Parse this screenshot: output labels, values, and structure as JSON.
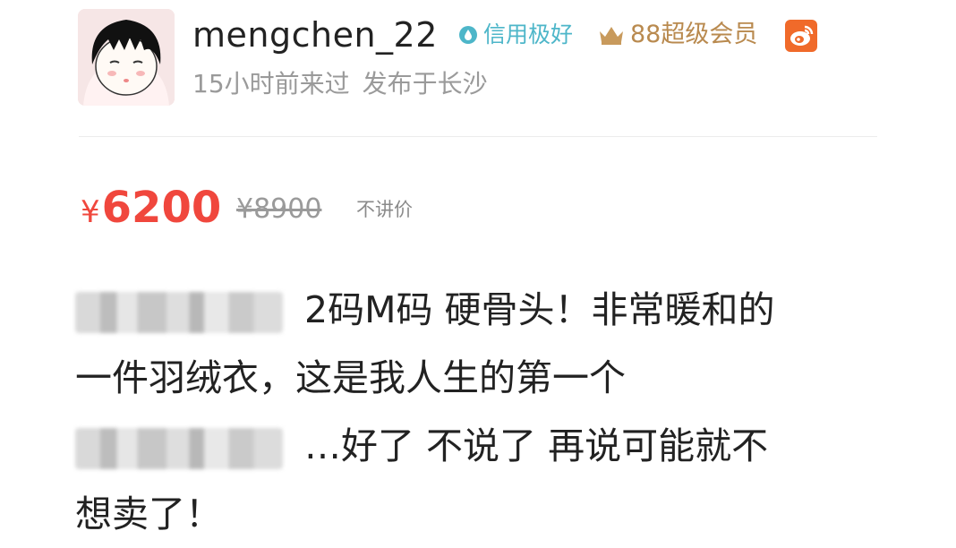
{
  "profile": {
    "username": "mengchen_22",
    "credit_badge": "信用极好",
    "vip_badge": "88超级会员",
    "last_seen": "15小时前来过",
    "location": "发布于长沙"
  },
  "listing": {
    "currency_symbol": "¥",
    "price": "6200",
    "original_price": "¥8900",
    "bargain_note": "不讲价",
    "description": {
      "line1": "2码M码 硬骨头！非常暖和的",
      "line2": "一件羽绒衣，这是我人生的第一个",
      "line3": "…好了 不说了 再说可能就不",
      "line4": "想卖了！"
    }
  },
  "colors": {
    "price_red": "#f0473d",
    "credit_teal": "#4db6c9",
    "vip_gold": "#b98a4f",
    "weibo_orange": "#f06a2a",
    "meta_gray": "#9a9a9a"
  },
  "icons": [
    "avatar",
    "credit-drop-icon",
    "crown-icon",
    "weibo-icon"
  ]
}
